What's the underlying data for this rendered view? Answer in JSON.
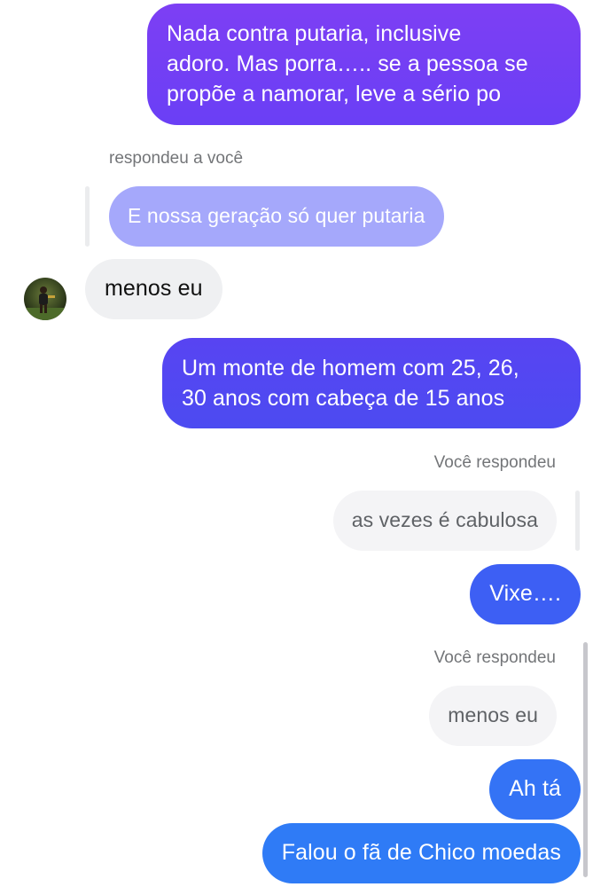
{
  "messages": {
    "m1": {
      "lines": [
        "Nada contra putaria, inclusive",
        "adoro. Mas porra….. se a pessoa se",
        "propõe a namorar, leve a sério po"
      ]
    },
    "reply1": {
      "label": "respondeu a você",
      "quote": "E nossa geração só quer putaria"
    },
    "m2": {
      "text": "menos eu"
    },
    "m3": {
      "lines": [
        "Um monte de homem com 25, 26,",
        "30 anos com cabeça de 15 anos"
      ]
    },
    "reply2": {
      "label": "Você respondeu",
      "quote": "as vezes é cabulosa"
    },
    "m4": {
      "text": "Vixe…."
    },
    "reply3": {
      "label": "Você respondeu",
      "quote": "menos eu"
    },
    "m5": {
      "text": "Ah tá"
    },
    "m6": {
      "text": "Falou o fã de Chico moedas"
    }
  },
  "colors": {
    "gradient_top": "#7a3cf5",
    "gradient_mid": "#4f48f0",
    "gradient_bottom": "#2f7cf6",
    "received_bg": "#eff0f2",
    "reply_quote_bg": "#a5a8fb"
  },
  "avatar": {
    "icon": "user-avatar-photo"
  }
}
